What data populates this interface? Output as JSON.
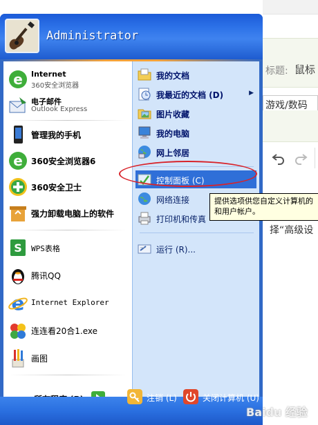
{
  "background": {
    "title_label": "标题:",
    "title_value": "鼠标",
    "category_value": "游戏/数码",
    "hint_text": "择“高级设",
    "watermark": "Baidu 经验"
  },
  "start_menu": {
    "username": "Administrator",
    "left_items": [
      {
        "name": "internet",
        "line1": "Internet",
        "line2": "360安全浏览器"
      },
      {
        "name": "email",
        "line1": "电子邮件",
        "line2": "Outlook Express"
      },
      {
        "name": "manage-phone",
        "label": "管理我的手机"
      },
      {
        "name": "360-browser-6",
        "label": "360安全浏览器6"
      },
      {
        "name": "360-guard",
        "label": "360安全卫士"
      },
      {
        "name": "uninstall-software",
        "label": "强力卸载电脑上的软件"
      },
      {
        "name": "wps-spreadsheet",
        "label": "WPS表格"
      },
      {
        "name": "tencent-qq",
        "label": "腾讯QQ"
      },
      {
        "name": "internet-explorer",
        "label": "Internet Explorer"
      },
      {
        "name": "lianliankan",
        "label": "连连看20合1.exe"
      },
      {
        "name": "paint",
        "label": "画图"
      }
    ],
    "all_programs_label": "所有程序 (P)",
    "right_items": [
      {
        "name": "my-documents",
        "label": "我的文档"
      },
      {
        "name": "recent-documents",
        "label": "我最近的文档 (D)"
      },
      {
        "name": "my-pictures",
        "label": "图片收藏"
      },
      {
        "name": "my-computer",
        "label": "我的电脑"
      },
      {
        "name": "network-places",
        "label": "网上邻居"
      },
      {
        "name": "control-panel",
        "label": "控制面板 (C)"
      },
      {
        "name": "network-connections",
        "label": "网络连接"
      },
      {
        "name": "printers-faxes",
        "label": "打印机和传真"
      },
      {
        "name": "run",
        "label": "运行 (R)..."
      }
    ],
    "tooltip": {
      "line1": "提供选项供您自定义计算机的",
      "line2": "和用户帐户。"
    },
    "footer": {
      "logoff_label": "注销 (L)",
      "shutdown_label": "关闭计算机 (U)"
    }
  },
  "colors": {
    "menu_blue": "#3169c6",
    "right_pane": "#d3e5fa",
    "highlight": "#2f6fd8",
    "annotation_red": "#d8232a",
    "tooltip_bg": "#ffffe1"
  }
}
